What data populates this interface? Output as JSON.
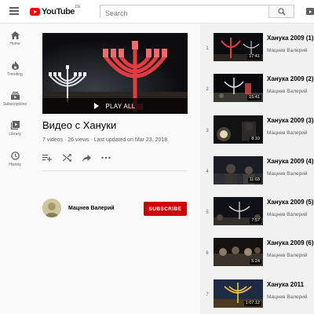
{
  "app": {
    "logo_text": "YouTube",
    "logo_country": "DE",
    "brand_color": "#ff0000",
    "accent_color": "#cc0000"
  },
  "search": {
    "placeholder": "Search"
  },
  "guide": {
    "items": [
      {
        "label": "Home",
        "icon": "home-icon"
      },
      {
        "label": "Trending",
        "icon": "flame-icon"
      },
      {
        "label": "Subscriptions",
        "icon": "subscriptions-icon"
      },
      {
        "label": "Library",
        "icon": "library-icon"
      },
      {
        "label": "History",
        "icon": "history-icon"
      }
    ]
  },
  "playlist": {
    "play_all_label": "PLAY ALL",
    "title": "Видео с Хануки",
    "stats": "7 videos · 26 views · Last updated on Mar 23, 2018",
    "owner_name": "Мацнев Валерий",
    "subscribe_label": "SUBSCRIBE",
    "actions": [
      "add-to-queue-icon",
      "shuffle-icon",
      "share-icon",
      "more-icon"
    ]
  },
  "videos": [
    {
      "index": "1",
      "title": "Ханука 2009 (1)",
      "channel": "Мацнев Валерий",
      "duration": "17:41"
    },
    {
      "index": "2",
      "title": "Ханука 2009 (2)",
      "channel": "Мацнев Валерий",
      "duration": "15:41"
    },
    {
      "index": "3",
      "title": "Ханука 2009 (3)",
      "channel": "Мацнев Валерий",
      "duration": "8:10"
    },
    {
      "index": "4",
      "title": "Ханука 2009 (4)",
      "channel": "Мацнев Валерий",
      "duration": "11:03"
    },
    {
      "index": "5",
      "title": "Ханука 2009 (5)",
      "channel": "Мацнев Валерий",
      "duration": "7:57"
    },
    {
      "index": "6",
      "title": "Ханука 2009 (6)",
      "channel": "Мацнев Валерий",
      "duration": "5:24"
    },
    {
      "index": "7",
      "title": "Ханука 2011",
      "channel": "Мацнев Валерий",
      "duration": "1:07:12"
    }
  ]
}
